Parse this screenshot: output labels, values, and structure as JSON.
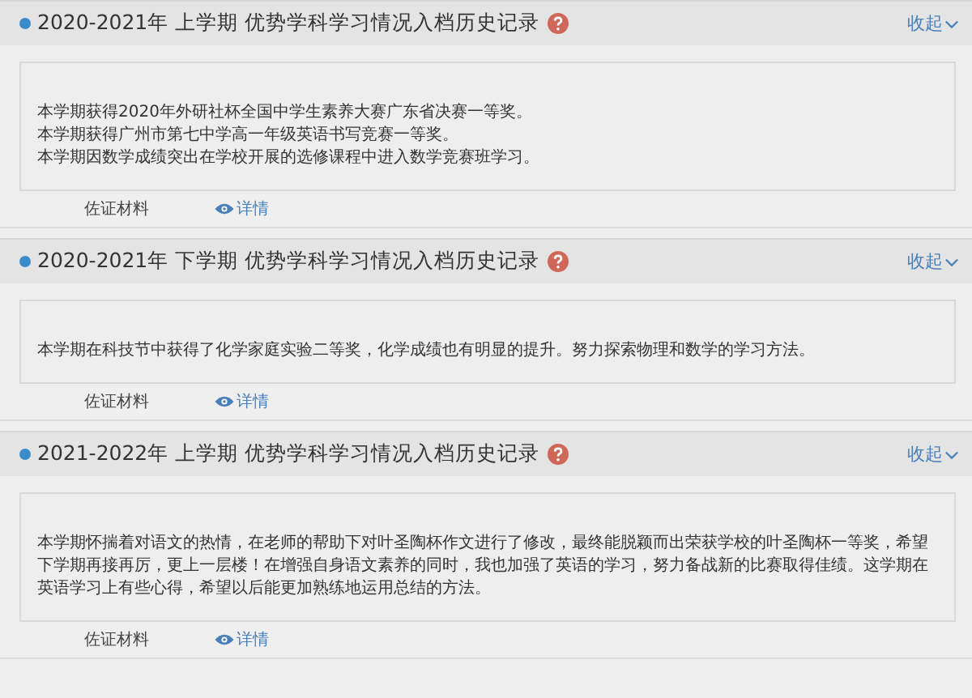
{
  "records": [
    {
      "title": "2020-2021年 上学期 优势学科学习情况入档历史记录",
      "toggle": "收起",
      "expanded": true,
      "lines": [
        "本学期获得2020年外研社杯全国中学生素养大赛广东省决赛一等奖。",
        "本学期获得广州市第七中学高一年级英语书写竞赛一等奖。",
        "本学期因数学成绩突出在学校开展的选修课程中进入数学竞赛班学习。"
      ],
      "evidence_label": "佐证材料",
      "details_link": "详情"
    },
    {
      "title": "2020-2021年 下学期 优势学科学习情况入档历史记录",
      "toggle": "收起",
      "expanded": true,
      "lines": [
        "本学期在科技节中获得了化学家庭实验二等奖，化学成绩也有明显的提升。努力探索物理和数学的学习方法。"
      ],
      "evidence_label": "佐证材料",
      "details_link": "详情"
    },
    {
      "title": "2021-2022年 上学期 优势学科学习情况入档历史记录",
      "toggle": "收起",
      "expanded": true,
      "lines": [
        "本学期怀揣着对语文的热情，在老师的帮助下对叶圣陶杯作文进行了修改，最终能脱颖而出荣获学校的叶圣陶杯一等奖，希望下学期再接再厉，更上一层楼！在增强自身语文素养的同时，我也加强了英语的学习，努力备战新的比赛取得佳绩。这学期在英语学习上有些心得，希望以后能更加熟练地运用总结的方法。"
      ],
      "evidence_label": "佐证材料",
      "details_link": "详情"
    }
  ]
}
